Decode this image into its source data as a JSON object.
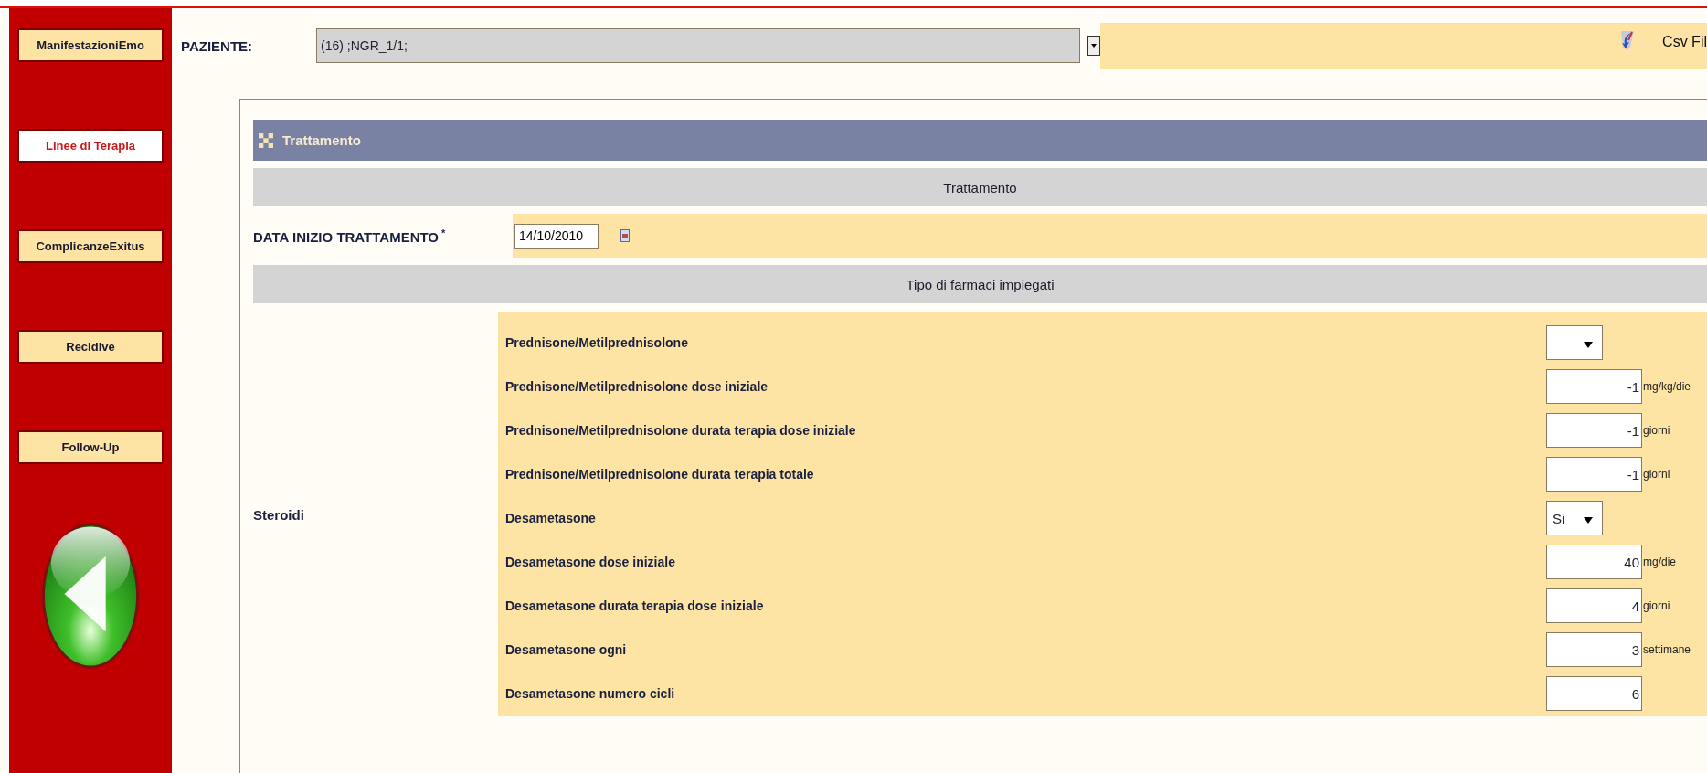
{
  "sidebar": {
    "items": [
      {
        "label": "ManifestazioniEmo",
        "selected": false
      },
      {
        "label": "Linee di Terapia",
        "selected": true
      },
      {
        "label": "ComplicanzeExitus",
        "selected": false
      },
      {
        "label": "Recidive",
        "selected": false
      },
      {
        "label": "Follow-Up",
        "selected": false
      }
    ]
  },
  "patient": {
    "label": "PAZIENTE:",
    "value": "(16) ;NGR_1/1;"
  },
  "export_link": "Csv Fil",
  "panel": {
    "title": "Trattamento",
    "section_1": "Trattamento",
    "start_date": {
      "label": "DATA INIZIO TRATTAMENTO",
      "required_mark": "*",
      "value": "14/10/2010"
    },
    "section_2": "Tipo di farmaci impiegati",
    "group": "Steroidi",
    "rows": [
      {
        "label": "Prednisone/Metilprednisolone",
        "kind": "select"
      },
      {
        "label": "Prednisone/Metilprednisolone dose iniziale",
        "kind": "number",
        "value": "-1",
        "unit": "mg/kg/die"
      },
      {
        "label": "Prednisone/Metilprednisolone durata terapia dose iniziale",
        "kind": "number",
        "value": "-1",
        "unit": "giorni"
      },
      {
        "label": "Prednisone/Metilprednisolone durata terapia totale",
        "kind": "number",
        "value": "-1",
        "unit": "giorni"
      },
      {
        "label": "Desametasone",
        "kind": "select",
        "value": "Si"
      },
      {
        "label": "Desametasone dose iniziale",
        "kind": "number",
        "value": "40",
        "unit": "mg/die"
      },
      {
        "label": "Desametasone durata terapia dose iniziale",
        "kind": "number",
        "value": "4",
        "unit": "giorni"
      },
      {
        "label": "Desametasone ogni",
        "kind": "number",
        "value": "3",
        "unit": "settimane"
      },
      {
        "label": "Desametasone numero cicli",
        "kind": "number",
        "value": "6"
      }
    ]
  }
}
